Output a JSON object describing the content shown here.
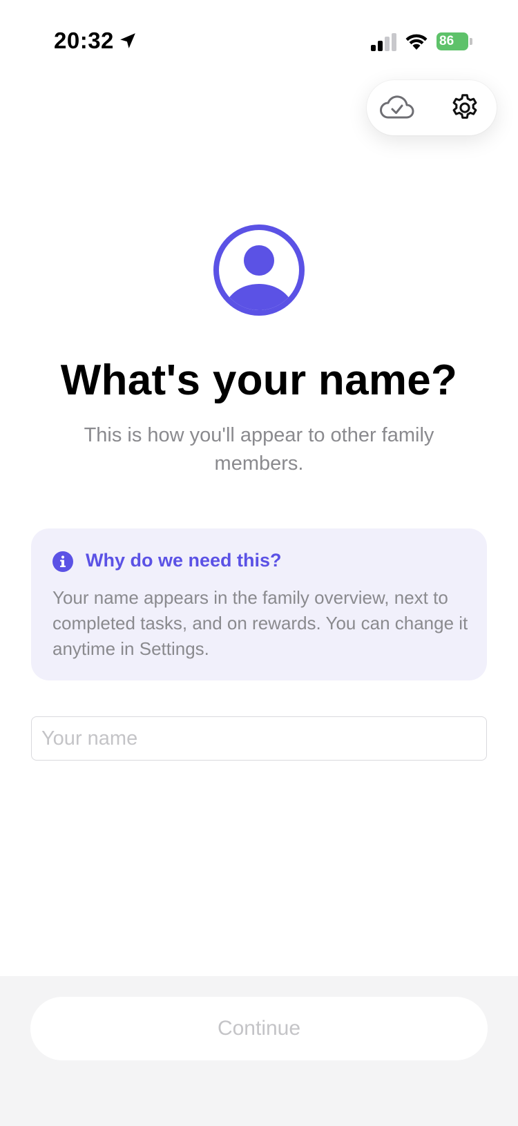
{
  "status_bar": {
    "time": "20:32",
    "battery_level": "86",
    "battery_color": "#5ec26a"
  },
  "top_actions": {
    "cloud_icon": "cloud-check-icon",
    "settings_icon": "gear-icon"
  },
  "onboarding": {
    "avatar_icon": "person-circle-icon",
    "title": "What's your name?",
    "subtitle": "This is how you'll appear to other family members."
  },
  "info_card": {
    "icon": "info-icon",
    "heading": "Why do we need this?",
    "body": "Your name appears in the family overview, next to completed tasks, and on rewards. You can change it anytime in Settings."
  },
  "name_field": {
    "value": "",
    "placeholder": "Your name"
  },
  "footer": {
    "continue_label": "Continue"
  },
  "colors": {
    "accent": "#5b52e5",
    "info_background": "#f1f0fb",
    "muted_text": "#8a8a8e"
  }
}
